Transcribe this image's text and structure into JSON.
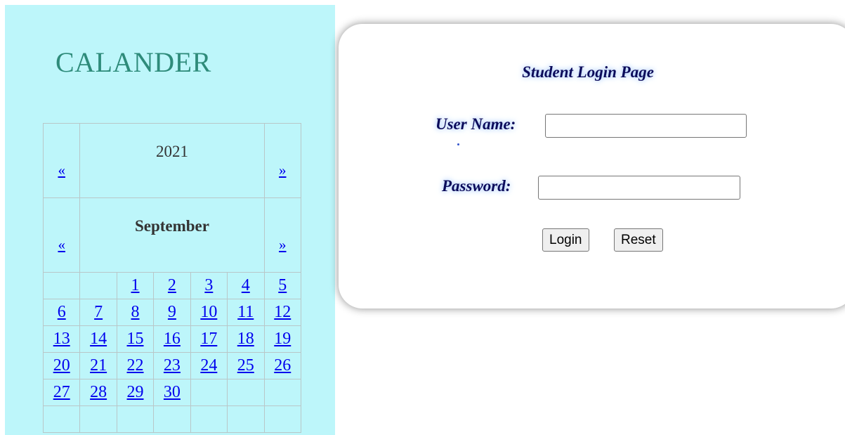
{
  "calendar": {
    "title": "CALANDER",
    "year": "2021",
    "month": "September",
    "prev_arrow": "«",
    "next_arrow": "»",
    "weeks": [
      [
        "",
        "",
        "1",
        "2",
        "3",
        "4",
        "5"
      ],
      [
        "6",
        "7",
        "8",
        "9",
        "10",
        "11",
        "12"
      ],
      [
        "13",
        "14",
        "15",
        "16",
        "17",
        "18",
        "19"
      ],
      [
        "20",
        "21",
        "22",
        "23",
        "24",
        "25",
        "26"
      ],
      [
        "27",
        "28",
        "29",
        "30",
        "",
        "",
        ""
      ],
      [
        "",
        "",
        "",
        "",
        "",
        "",
        ""
      ]
    ]
  },
  "login": {
    "heading": "Student Login Page",
    "username_label": "User Name:",
    "username_value": "",
    "password_label": "Password:",
    "password_value": "",
    "login_button": "Login",
    "reset_button": "Reset"
  },
  "colors": {
    "calendar_bg": "#bdf6fa",
    "title_color": "#2e8b7a",
    "link_color": "#0000ee",
    "label_color": "#0b0b5a"
  }
}
